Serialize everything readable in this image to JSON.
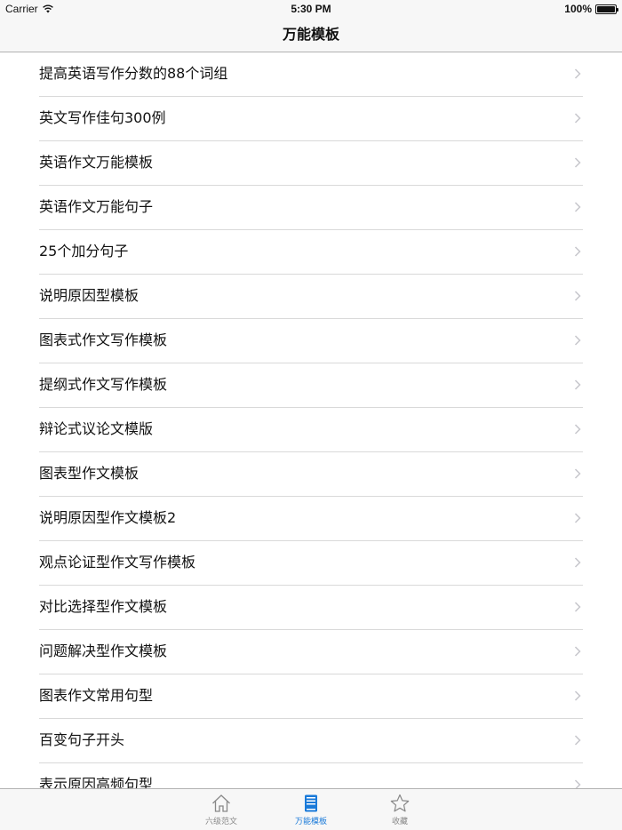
{
  "status": {
    "carrier": "Carrier",
    "time": "5:30 PM",
    "battery": "100%"
  },
  "nav": {
    "title": "万能模板"
  },
  "list": {
    "items": [
      "提高英语写作分数的88个词组",
      "英文写作佳句300例",
      "英语作文万能模板",
      "英语作文万能句子",
      "25个加分句子",
      "说明原因型模板",
      "图表式作文写作模板",
      "提纲式作文写作模板",
      "辩论式议论文模版",
      "图表型作文模板",
      "说明原因型作文模板2",
      "观点论证型作文写作模板",
      "对比选择型作文模板",
      "问题解决型作文模板",
      "图表作文常用句型",
      "百变句子开头",
      "表示原因高频句型"
    ]
  },
  "tabs": [
    {
      "label": "六级范文",
      "icon": "house-icon",
      "active": false
    },
    {
      "label": "万能模板",
      "icon": "book-icon",
      "active": true
    },
    {
      "label": "收藏",
      "icon": "star-icon",
      "active": false
    }
  ],
  "colors": {
    "accent": "#1a7ad9",
    "inactive": "#888888",
    "separator": "#d9d9d9"
  }
}
